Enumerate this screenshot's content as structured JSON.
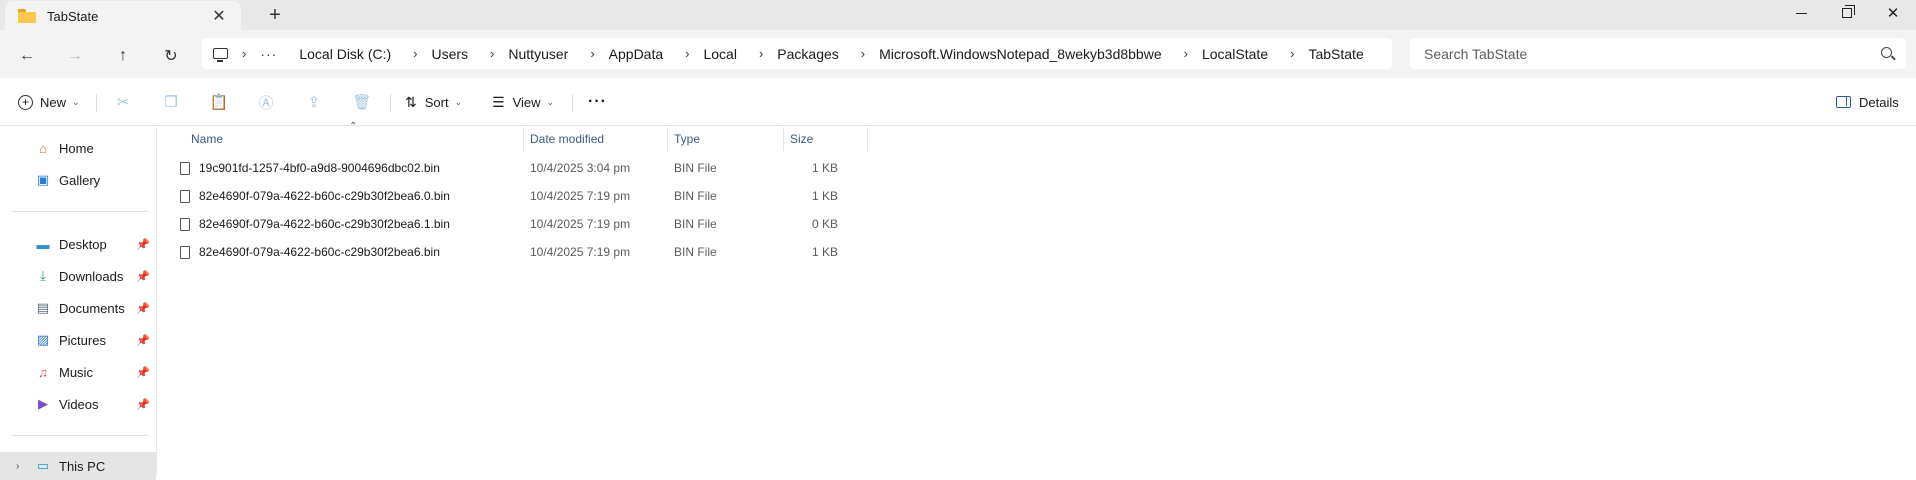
{
  "tab": {
    "title": "TabState"
  },
  "breadcrumb": {
    "overflow": "···",
    "items": [
      "Local Disk (C:)",
      "Users",
      "Nuttyuser",
      "AppData",
      "Local",
      "Packages",
      "Microsoft.WindowsNotepad_8wekyb3d8bbwe",
      "LocalState",
      "TabState"
    ]
  },
  "search": {
    "placeholder": "Search TabState"
  },
  "toolbar": {
    "new_label": "New",
    "sort_label": "Sort",
    "view_label": "View",
    "more_label": "···",
    "details_label": "Details"
  },
  "sidebar": {
    "items": [
      {
        "label": "Home"
      },
      {
        "label": "Gallery"
      },
      {
        "label": "Desktop"
      },
      {
        "label": "Downloads"
      },
      {
        "label": "Documents"
      },
      {
        "label": "Pictures"
      },
      {
        "label": "Music"
      },
      {
        "label": "Videos"
      },
      {
        "label": "This PC"
      }
    ]
  },
  "columns": {
    "name": "Name",
    "date": "Date modified",
    "type": "Type",
    "size": "Size"
  },
  "files": [
    {
      "name": "19c901fd-1257-4bf0-a9d8-9004696dbc02.bin",
      "date": "10/4/2025 3:04 pm",
      "type": "BIN File",
      "size": "1 KB"
    },
    {
      "name": "82e4690f-079a-4622-b60c-c29b30f2bea6.0.bin",
      "date": "10/4/2025 7:19 pm",
      "type": "BIN File",
      "size": "1 KB"
    },
    {
      "name": "82e4690f-079a-4622-b60c-c29b30f2bea6.1.bin",
      "date": "10/4/2025 7:19 pm",
      "type": "BIN File",
      "size": "0 KB"
    },
    {
      "name": "82e4690f-079a-4622-b60c-c29b30f2bea6.bin",
      "date": "10/4/2025 7:19 pm",
      "type": "BIN File",
      "size": "1 KB"
    }
  ],
  "colors": {
    "accent": "#2b5d9c",
    "header_text": "#3c5a80",
    "folder": "#f8c94a"
  }
}
